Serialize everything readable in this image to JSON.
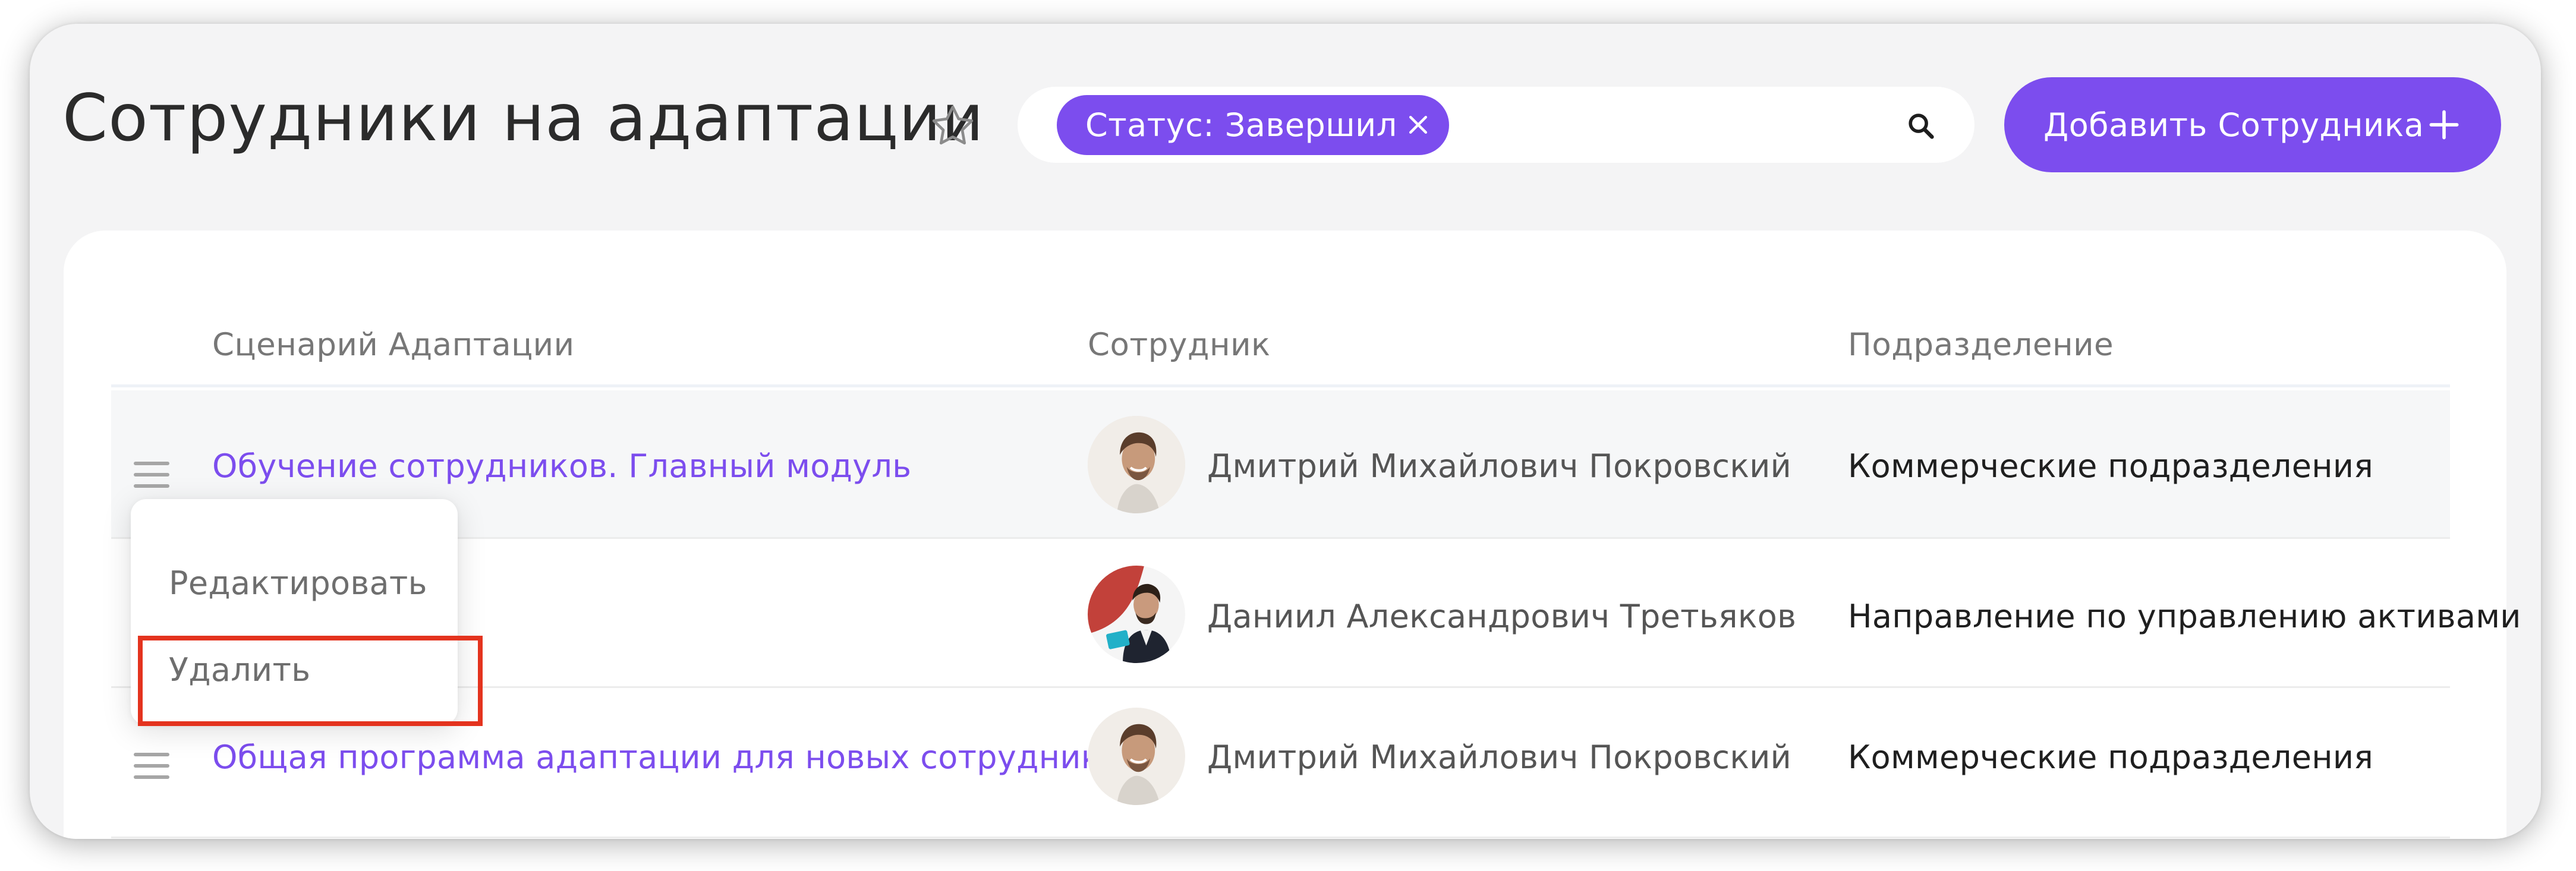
{
  "header": {
    "title": "Сотрудники на адаптации",
    "favorite_icon": "star-icon",
    "search": {
      "filter_chip_label": "Статус: Завершил",
      "chip_close_icon": "close-icon",
      "search_icon": "search-icon"
    },
    "add_button_label": "Добавить Сотрудника",
    "add_button_icon": "plus-icon"
  },
  "table": {
    "columns": [
      "Сценарий Адаптации",
      "Сотрудник",
      "Подразделение"
    ],
    "rows": [
      {
        "scenario": "Обучение сотрудников. Главный модуль",
        "employee": "Дмитрий Михайлович Покровский",
        "department": "Коммерческие подразделения"
      },
      {
        "scenario": "",
        "employee": "Даниил Александрович Третьяков",
        "department": "Направление по управлению активами"
      },
      {
        "scenario": "Общая программа адаптации для новых сотрудников",
        "employee": "Дмитрий Михайлович Покровский",
        "department": "Коммерческие подразделения"
      }
    ]
  },
  "context_menu": {
    "items": [
      "Редактировать",
      "Удалить"
    ]
  },
  "colors": {
    "accent": "#7c4dee",
    "highlight_border": "#e4331e",
    "background": "#f4f4f5"
  }
}
